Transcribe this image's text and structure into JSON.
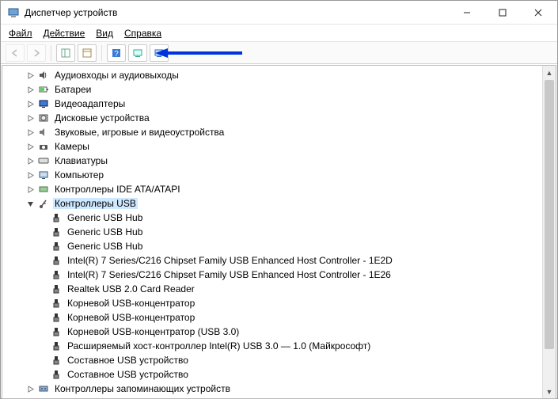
{
  "window": {
    "title": "Диспетчер устройств"
  },
  "menus": {
    "file": "Файл",
    "action": "Действие",
    "view": "Вид",
    "help": "Справка"
  },
  "tree": {
    "categories": [
      {
        "label": "Аудиовходы и аудиовыходы",
        "icon": "speaker-icon",
        "expanded": false
      },
      {
        "label": "Батареи",
        "icon": "battery-icon",
        "expanded": false
      },
      {
        "label": "Видеоадаптеры",
        "icon": "display-adapter-icon",
        "expanded": false
      },
      {
        "label": "Дисковые устройства",
        "icon": "disk-icon",
        "expanded": false
      },
      {
        "label": "Звуковые, игровые и видеоустройства",
        "icon": "sound-icon",
        "expanded": false
      },
      {
        "label": "Камеры",
        "icon": "camera-icon",
        "expanded": false
      },
      {
        "label": "Клавиатуры",
        "icon": "keyboard-icon",
        "expanded": false
      },
      {
        "label": "Компьютер",
        "icon": "computer-icon",
        "expanded": false
      },
      {
        "label": "Контроллеры IDE ATA/ATAPI",
        "icon": "ide-icon",
        "expanded": false
      },
      {
        "label": "Контроллеры USB",
        "icon": "usb-icon",
        "expanded": true,
        "selected": true,
        "children": [
          {
            "label": "Generic USB Hub",
            "icon": "usb-plug-icon"
          },
          {
            "label": "Generic USB Hub",
            "icon": "usb-plug-icon"
          },
          {
            "label": "Generic USB Hub",
            "icon": "usb-plug-icon"
          },
          {
            "label": "Intel(R) 7 Series/C216 Chipset Family USB Enhanced Host Controller - 1E2D",
            "icon": "usb-plug-icon"
          },
          {
            "label": "Intel(R) 7 Series/C216 Chipset Family USB Enhanced Host Controller - 1E26",
            "icon": "usb-plug-icon"
          },
          {
            "label": "Realtek USB 2.0 Card Reader",
            "icon": "usb-plug-icon"
          },
          {
            "label": "Корневой USB-концентратор",
            "icon": "usb-plug-icon"
          },
          {
            "label": "Корневой USB-концентратор",
            "icon": "usb-plug-icon"
          },
          {
            "label": "Корневой USB-концентратор (USB 3.0)",
            "icon": "usb-plug-icon"
          },
          {
            "label": "Расширяемый хост-контроллер Intel(R) USB 3.0 — 1.0 (Майкрософт)",
            "icon": "usb-plug-icon"
          },
          {
            "label": "Составное USB устройство",
            "icon": "usb-plug-icon"
          },
          {
            "label": "Составное USB устройство",
            "icon": "usb-plug-icon"
          }
        ]
      },
      {
        "label": "Контроллеры запоминающих устройств",
        "icon": "storage-controller-icon",
        "expanded": false
      }
    ]
  },
  "annotation_arrow_color": "#0033dd"
}
